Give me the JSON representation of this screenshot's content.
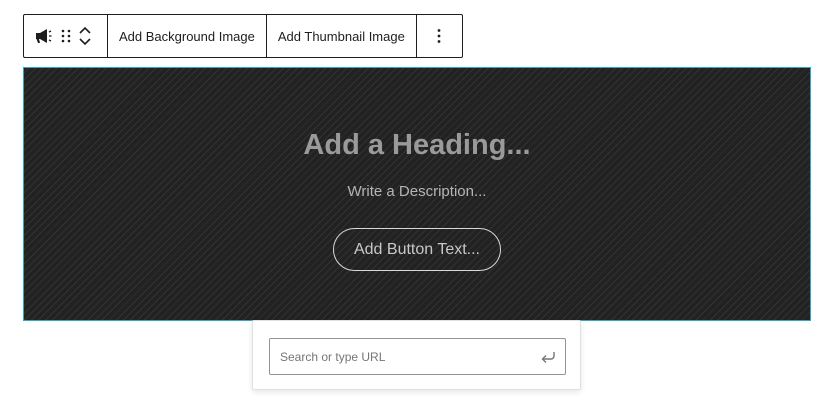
{
  "toolbar": {
    "block_icon": "megaphone-icon",
    "drag_icon": "drag-handle-icon",
    "move_up_icon": "chevron-up-icon",
    "move_down_icon": "chevron-down-icon",
    "add_background_label": "Add Background Image",
    "add_thumbnail_label": "Add Thumbnail Image",
    "options_icon": "vertical-ellipsis-icon"
  },
  "hero": {
    "heading": "Add a Heading...",
    "description": "Write a Description...",
    "button_text": "Add Button Text..."
  },
  "link_popover": {
    "placeholder": "Search or type URL",
    "value": "",
    "submit_icon": "enter-return-icon"
  },
  "colors": {
    "selection_outline": "#2ea8c8",
    "hero_background": "#222222",
    "toolbar_border": "#1e1e1e"
  }
}
